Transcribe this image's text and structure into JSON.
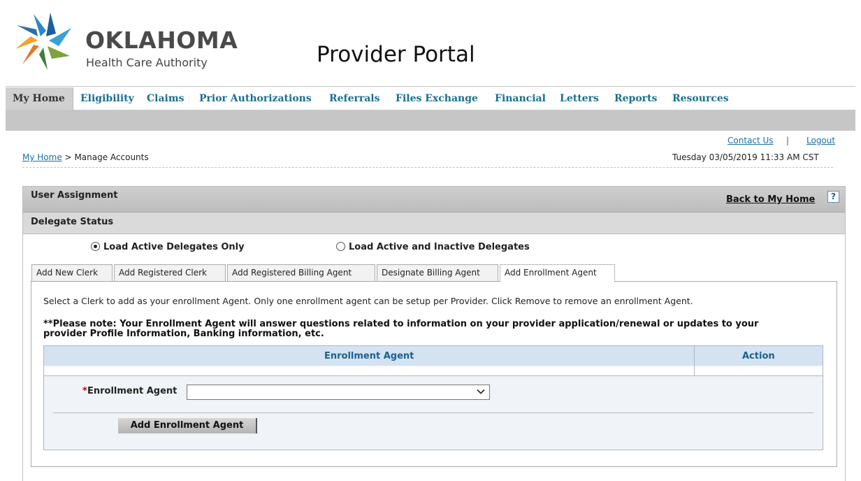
{
  "header": {
    "brand_name": "OKLAHOMA",
    "brand_sub": "Health Care Authority",
    "portal_title": "Provider Portal"
  },
  "nav": {
    "items": [
      "My Home",
      "Eligibility",
      "Claims",
      "Prior Authorizations",
      "Referrals",
      "Files Exchange",
      "Financial",
      "Letters",
      "Reports",
      "Resources"
    ]
  },
  "utility": {
    "contact_us": "Contact Us",
    "separator": "|",
    "logout": "Logout",
    "datetime": "Tuesday 03/05/2019 11:33 AM CST"
  },
  "breadcrumb": {
    "home": "My Home",
    "sep": ">",
    "current": "Manage Accounts"
  },
  "panel": {
    "title": "User Assignment",
    "back_link": "Back to My Home",
    "help": "?",
    "subtitle": "Delegate Status"
  },
  "radios": {
    "active_only": "Load Active Delegates Only",
    "active_inactive": "Load Active and Inactive Delegates",
    "selected": "active_only"
  },
  "tabs": [
    "Add New Clerk",
    "Add Registered Clerk",
    "Add Registered Billing Agent",
    "Designate Billing Agent",
    "Add Enrollment Agent"
  ],
  "content": {
    "instruction": "Select a Clerk to add as your enrollment Agent. Only one enrollment agent can be setup per Provider. Click Remove to remove an enrollment Agent.",
    "note_line1": "**Please note: Your Enrollment Agent will answer questions related to information on your provider application/renewal or updates to your",
    "note_line2": "provider Profile Information, Banking information, etc."
  },
  "table": {
    "col_agent": "Enrollment Agent",
    "col_action": "Action"
  },
  "form": {
    "required_mark": "*",
    "field_label": "Enrollment Agent",
    "select_value": "",
    "button": "Add Enrollment Agent"
  },
  "colors": {
    "nav_link": "#1b6f8f",
    "link": "#1d6fa5",
    "table_header_bg": "#d3e3f1",
    "required": "#cc0000"
  }
}
